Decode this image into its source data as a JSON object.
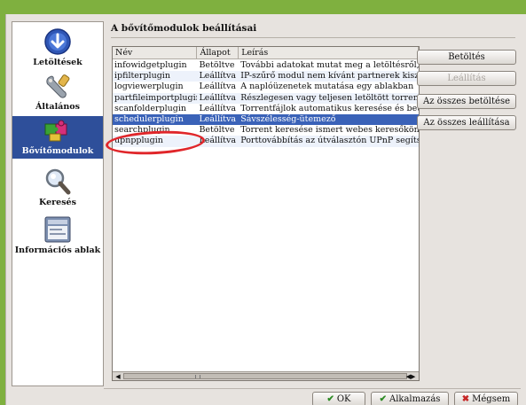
{
  "sidebar": {
    "items": [
      {
        "label": "Letöltések",
        "icon": "download-arrow-icon"
      },
      {
        "label": "Általános",
        "icon": "wrench-icon"
      },
      {
        "label": "Bővítőmodulok",
        "icon": "puzzle-plugin-icon"
      },
      {
        "label": "Keresés",
        "icon": "magnifier-icon"
      },
      {
        "label": "Információs ablak",
        "icon": "info-window-icon"
      }
    ],
    "selected_index": 2
  },
  "main": {
    "title": "A bővítőmodulok beállításai",
    "columns": [
      "Név",
      "Állapot",
      "Leírás"
    ],
    "rows": [
      {
        "name": "infowidgetplugin",
        "status": "Betöltve",
        "desc": "További adatokat mutat meg a letöltésről, p"
      },
      {
        "name": "ipfilterplugin",
        "status": "Leállítva",
        "desc": "IP-szűrő modul nem kívánt partnerek kiszű"
      },
      {
        "name": "logviewerplugin",
        "status": "Leállítva",
        "desc": "A naplóüzenetek mutatása egy ablakban"
      },
      {
        "name": "partfileimportplugin",
        "status": "Leállítva",
        "desc": "Részlegesen vagy teljesen letöltött torrente"
      },
      {
        "name": "scanfolderplugin",
        "status": "Leállítva",
        "desc": "Torrentfájlok automatikus keresése és betöl"
      },
      {
        "name": "schedulerplugin",
        "status": "Leállítva",
        "desc": "Sávszélesség-ütemező"
      },
      {
        "name": "searchplugin",
        "status": "Betöltve",
        "desc": "Torrent keresése ismert webes keresőkön"
      },
      {
        "name": "upnpplugin",
        "status": "Leállítva",
        "desc": "Porttovábbítás az útválasztón UPnP segítsé"
      }
    ],
    "selected_row": 5
  },
  "actions": {
    "load": "Betöltés",
    "unload": "Leállítás",
    "load_all": "Az összes betöltése",
    "unload_all": "Az összes leállítása"
  },
  "footer": {
    "ok": "OK",
    "apply": "Alkalmazás",
    "cancel": "Mégsem"
  },
  "colors": {
    "accent_selection": "#3a62b8",
    "highlight_ellipse": "#e0262a",
    "background_outer": "#7fb03f"
  }
}
